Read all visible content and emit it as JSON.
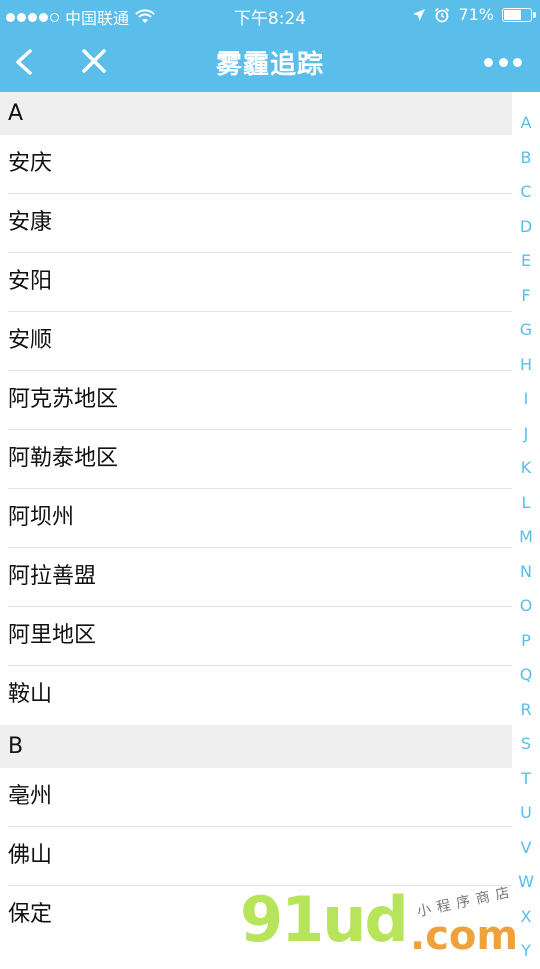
{
  "status_bar": {
    "carrier": "中国联通",
    "time": "下午8:24",
    "battery": "71%",
    "battery_level": 0.71
  },
  "navbar": {
    "title": "雾霾追踪",
    "back_icon": "chevron-left-icon",
    "close_icon": "close-icon",
    "more_icon": "more-dots-icon"
  },
  "sections": [
    {
      "letter": "A",
      "cities": [
        "安庆",
        "安康",
        "安阳",
        "安顺",
        "阿克苏地区",
        "阿勒泰地区",
        "阿坝州",
        "阿拉善盟",
        "阿里地区",
        "鞍山"
      ]
    },
    {
      "letter": "B",
      "cities": [
        "亳州",
        "佛山",
        "保定"
      ]
    }
  ],
  "index_letters": [
    "A",
    "B",
    "C",
    "D",
    "E",
    "F",
    "G",
    "H",
    "I",
    "J",
    "K",
    "L",
    "M",
    "N",
    "O",
    "P",
    "Q",
    "R",
    "S",
    "T",
    "U",
    "V",
    "W",
    "X",
    "Y"
  ],
  "watermark": {
    "brand": "91ud",
    "domain": ".com",
    "tagline": "小程序商店"
  },
  "colors": {
    "accent": "#5bbdea",
    "section_bg": "#efefef",
    "watermark_green": "#b7e45a",
    "watermark_orange": "#efa13b"
  }
}
